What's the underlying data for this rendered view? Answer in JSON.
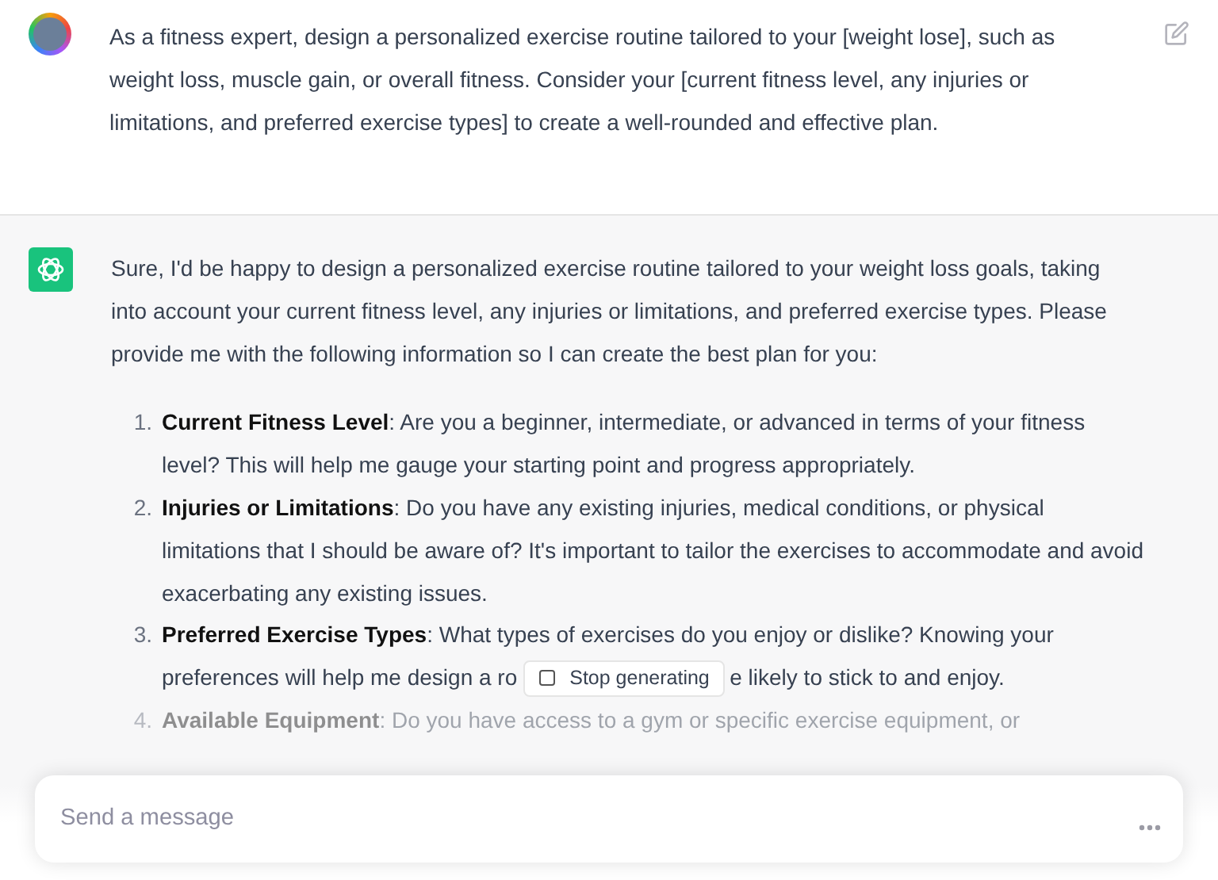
{
  "user_message": {
    "text": "As a fitness expert, design a personalized exercise routine tailored to your [weight lose], such as weight loss, muscle gain, or overall fitness. Consider your [current fitness level, any injuries or limitations, and preferred exercise types] to create a well-rounded and effective plan."
  },
  "assistant_message": {
    "intro": "Sure, I'd be happy to design a personalized exercise routine tailored to your weight loss goals, taking into account your current fitness level, any injuries or limitations, and preferred exercise types. Please provide me with the following information so I can create the best plan for you:",
    "items": [
      {
        "number": "1.",
        "text": "**Current Fitness Level**: Are you a beginner, intermediate, or advanced in terms of your fitness level? This will help me gauge your starting point and progress appropriately.",
        "faded": false
      },
      {
        "number": "2.",
        "text": "**Injuries or Limitations**: Do you have any existing injuries, medical conditions, or physical limitations that I should be aware of? It's important to tailor the exercises to accommodate and avoid exacerbating any existing issues.",
        "faded": false
      },
      {
        "number": "3.",
        "text": "**Preferred Exercise Types**: What types of exercises do you enjoy or dislike? Knowing your",
        "continued": "preferences will help me design a ro",
        "text_after": "e likely to stick to and enjoy.",
        "faded": false
      },
      {
        "number": "4.",
        "text": "**Available Equipment**: Do you have access to a gym or specific exercise equipment, or",
        "faded": true
      }
    ]
  },
  "stop_button": {
    "label": "Stop generating"
  },
  "composer": {
    "placeholder": "Send a message"
  }
}
